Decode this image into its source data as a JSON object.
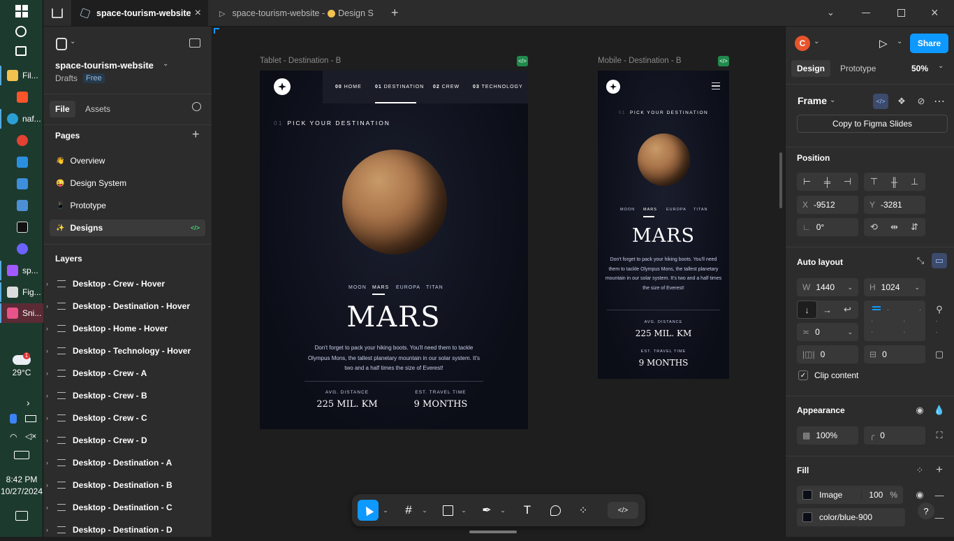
{
  "taskbar": {
    "items": [
      "Fil...",
      "naf...",
      "sp...",
      "Fig...",
      "Sni..."
    ],
    "weather_temp": "29°C",
    "weather_badge": "1",
    "time": "8:42 PM",
    "date": "10/27/2024"
  },
  "tabs": {
    "active_label": "space-tourism-website",
    "second_label": "space-tourism-website - ",
    "second_suffix": "Design S"
  },
  "file": {
    "name": "space-tourism-website",
    "location": "Drafts",
    "plan_badge": "Free",
    "tab_file": "File",
    "tab_assets": "Assets"
  },
  "pages": {
    "title": "Pages",
    "items": [
      {
        "label": "Overview",
        "emoji": "👋"
      },
      {
        "label": "Design System",
        "emoji": "😜"
      },
      {
        "label": "Prototype",
        "emoji": "📱"
      },
      {
        "label": "Designs",
        "emoji": "✨"
      }
    ]
  },
  "layers": {
    "title": "Layers",
    "items": [
      "Desktop - Crew - Hover",
      "Desktop - Destination - Hover",
      "Desktop - Home - Hover",
      "Desktop - Technology - Hover",
      "Desktop - Crew - A",
      "Desktop - Crew - B",
      "Desktop - Crew - C",
      "Desktop - Crew - D",
      "Desktop - Destination - A",
      "Desktop - Destination - B",
      "Desktop - Destination - C",
      "Desktop - Destination - D"
    ]
  },
  "canvas": {
    "tablet_frame_label": "Tablet - Destination - B",
    "mobile_frame_label": "Mobile - Destination - B",
    "nav": [
      {
        "num": "00",
        "label": "HOME"
      },
      {
        "num": "01",
        "label": "DESTINATION"
      },
      {
        "num": "02",
        "label": "CREW"
      },
      {
        "num": "03",
        "label": "TECHNOLOGY"
      }
    ],
    "heading_num": "01",
    "heading": "PICK YOUR DESTINATION",
    "dest_tabs": [
      "MOON",
      "MARS",
      "EUROPA",
      "TITAN"
    ],
    "planet_name": "MARS",
    "description": "Don't forget to pack your hiking boots. You'll need them to tackle Olympus Mons, the tallest planetary mountain in our solar system. It's two and a half times the size of Everest!",
    "stat1_label": "AVG. DISTANCE",
    "stat1_value": "225 MIL. KM",
    "stat2_label": "EST. TRAVEL TIME",
    "stat2_value": "9 MONTHS"
  },
  "rightpanel": {
    "avatar_letter": "C",
    "share": "Share",
    "tab_design": "Design",
    "tab_prototype": "Prototype",
    "zoom": "50%",
    "frame_label": "Frame",
    "copy_slides": "Copy to Figma Slides",
    "position_title": "Position",
    "x_label": "X",
    "x_value": "-9512",
    "y_label": "Y",
    "y_value": "-3281",
    "rotation": "0°",
    "autolayout_title": "Auto layout",
    "w_label": "W",
    "w_value": "1440",
    "h_label": "H",
    "h_value": "1024",
    "gap_value": "0",
    "pad_h": "0",
    "pad_v": "0",
    "clip_content": "Clip content",
    "appearance_title": "Appearance",
    "opacity": "100%",
    "radius": "0",
    "fill_title": "Fill",
    "fill_type": "Image",
    "fill_opacity": "100",
    "fill_percent": "%",
    "fill_color": "color/blue-900",
    "help": "?"
  },
  "colors": {
    "accent": "#0d99ff",
    "brand_share": "#0d99ff",
    "avatar": "#e8542c",
    "space_bg": "#0b0d17",
    "mars": "#b07a4a"
  }
}
